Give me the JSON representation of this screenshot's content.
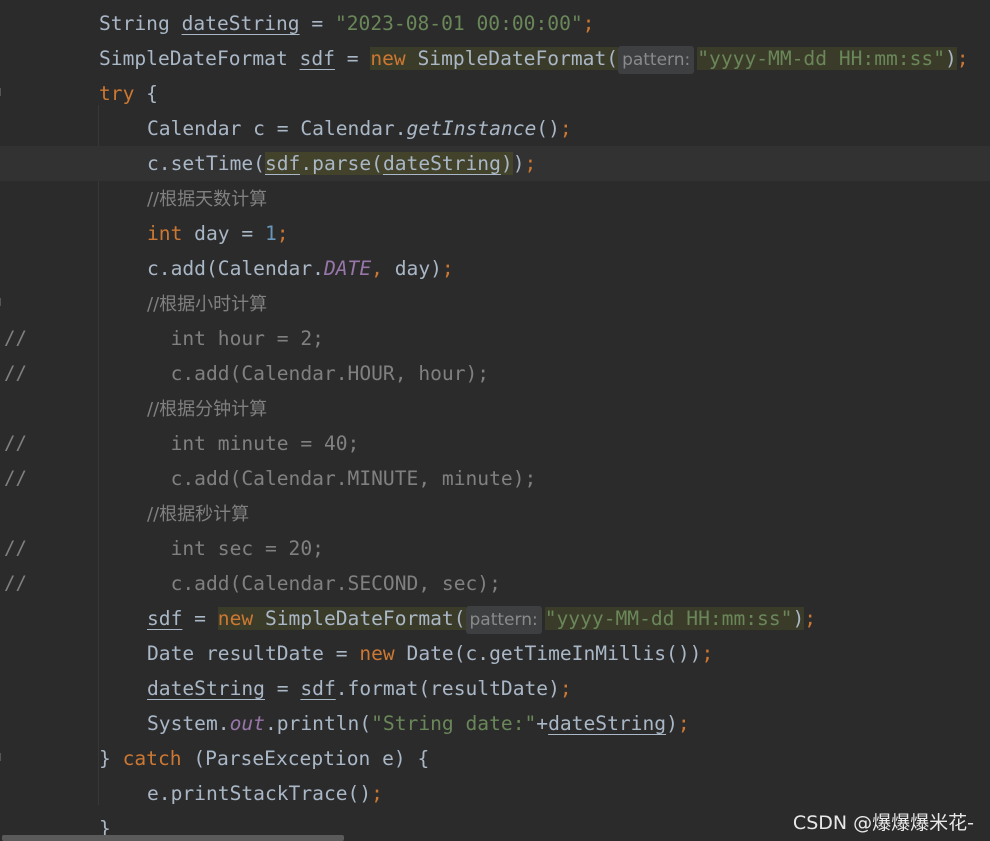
{
  "lines": [
    {
      "gutter": "",
      "segments": [
        {
          "t": "String ",
          "c": "p"
        },
        {
          "t": "dateString",
          "c": "p uline"
        },
        {
          "t": " = ",
          "c": "p"
        },
        {
          "t": "\"2023-08-01 00:00:00\"",
          "c": "str"
        },
        {
          "t": ";",
          "c": "kw"
        }
      ]
    },
    {
      "gutter": "",
      "segments": [
        {
          "t": "SimpleDateFormat ",
          "c": "p"
        },
        {
          "t": "sdf",
          "c": "p uline"
        },
        {
          "t": " = ",
          "c": "p"
        },
        {
          "t": "new",
          "c": "kw hl"
        },
        {
          "t": " SimpleDateFormat(",
          "c": "p hl"
        },
        {
          "t": "pattern:",
          "c": "hint"
        },
        {
          "t": "\"yyyy-MM-dd HH:mm:ss\"",
          "c": "str hl"
        },
        {
          "t": ")",
          "c": "p hl"
        },
        {
          "t": ";",
          "c": "kw"
        }
      ]
    },
    {
      "gutter": "",
      "segments": [
        {
          "t": "try",
          "c": "kw"
        },
        {
          "t": " {",
          "c": "p"
        }
      ]
    },
    {
      "gutter": "",
      "segments": [
        {
          "t": "Calendar c = Calendar.",
          "c": "p"
        },
        {
          "t": "getInstance",
          "c": "p mth"
        },
        {
          "t": "()",
          "c": "p"
        },
        {
          "t": ";",
          "c": "kw"
        }
      ]
    },
    {
      "gutter": "",
      "current": true,
      "segments": [
        {
          "t": "c.setTime(",
          "c": "p"
        },
        {
          "t": "sdf",
          "c": "p uline hlb"
        },
        {
          "t": ".parse(",
          "c": "p hlb"
        },
        {
          "t": "dateString",
          "c": "p uline hlb"
        },
        {
          "t": ")",
          "c": "p hlb"
        },
        {
          "t": ")",
          "c": "p"
        },
        {
          "t": ";",
          "c": "kw"
        }
      ]
    },
    {
      "gutter": "",
      "segments": [
        {
          "t": "//根据天数计算",
          "c": "cm"
        }
      ]
    },
    {
      "gutter": "",
      "segments": [
        {
          "t": "int",
          "c": "kw"
        },
        {
          "t": " day = ",
          "c": "p"
        },
        {
          "t": "1",
          "c": "num"
        },
        {
          "t": ";",
          "c": "kw"
        }
      ]
    },
    {
      "gutter": "",
      "segments": [
        {
          "t": "c.add(Calendar.",
          "c": "p"
        },
        {
          "t": "DATE",
          "c": "field"
        },
        {
          "t": ", ",
          "c": "kw"
        },
        {
          "t": "day)",
          "c": "p"
        },
        {
          "t": ";",
          "c": "kw"
        }
      ]
    },
    {
      "gutter": "",
      "segments": [
        {
          "t": "//根据小时计算",
          "c": "cm"
        }
      ]
    },
    {
      "gutter": "//",
      "segments": [
        {
          "t": "  int hour = 2;",
          "c": "cmm"
        }
      ]
    },
    {
      "gutter": "//",
      "segments": [
        {
          "t": "  c.add(Calendar.HOUR, hour);",
          "c": "cmm"
        }
      ]
    },
    {
      "gutter": "",
      "segments": [
        {
          "t": "//根据分钟计算",
          "c": "cm"
        }
      ]
    },
    {
      "gutter": "//",
      "segments": [
        {
          "t": "  int minute = 40;",
          "c": "cmm"
        }
      ]
    },
    {
      "gutter": "//",
      "segments": [
        {
          "t": "  c.add(Calendar.MINUTE, minute);",
          "c": "cmm"
        }
      ]
    },
    {
      "gutter": "",
      "segments": [
        {
          "t": "//根据秒计算",
          "c": "cm"
        }
      ]
    },
    {
      "gutter": "//",
      "segments": [
        {
          "t": "  int sec = 20;",
          "c": "cmm"
        }
      ]
    },
    {
      "gutter": "//",
      "segments": [
        {
          "t": "  c.add(Calendar.SECOND, sec);",
          "c": "cmm"
        }
      ]
    },
    {
      "gutter": "",
      "segments": [
        {
          "t": "sdf",
          "c": "p uline"
        },
        {
          "t": " = ",
          "c": "p"
        },
        {
          "t": "new",
          "c": "kw hl"
        },
        {
          "t": " SimpleDateFormat(",
          "c": "p hl"
        },
        {
          "t": "pattern:",
          "c": "hint"
        },
        {
          "t": "\"yyyy-MM-dd HH:mm:ss\"",
          "c": "str hl"
        },
        {
          "t": ")",
          "c": "p hl"
        },
        {
          "t": ";",
          "c": "kw"
        }
      ]
    },
    {
      "gutter": "",
      "segments": [
        {
          "t": "Date resultDate = ",
          "c": "p"
        },
        {
          "t": "new",
          "c": "kw"
        },
        {
          "t": " Date(c.getTimeInMillis())",
          "c": "p"
        },
        {
          "t": ";",
          "c": "kw"
        }
      ]
    },
    {
      "gutter": "",
      "segments": [
        {
          "t": "dateString",
          "c": "p uline"
        },
        {
          "t": " = ",
          "c": "p"
        },
        {
          "t": "sdf",
          "c": "p uline"
        },
        {
          "t": ".format(resultDate)",
          "c": "p"
        },
        {
          "t": ";",
          "c": "kw"
        }
      ]
    },
    {
      "gutter": "",
      "segments": [
        {
          "t": "System.",
          "c": "p"
        },
        {
          "t": "out",
          "c": "field"
        },
        {
          "t": ".println(",
          "c": "p"
        },
        {
          "t": "\"String date:\"",
          "c": "str"
        },
        {
          "t": "+",
          "c": "p"
        },
        {
          "t": "dateString",
          "c": "p uline"
        },
        {
          "t": ")",
          "c": "p"
        },
        {
          "t": ";",
          "c": "kw"
        }
      ]
    },
    {
      "gutter": "",
      "segments": [
        {
          "t": "} ",
          "c": "p"
        },
        {
          "t": "catch",
          "c": "kw"
        },
        {
          "t": " (ParseException e) {",
          "c": "p"
        }
      ]
    },
    {
      "gutter": "",
      "segments": [
        {
          "t": "e.printStackTrace()",
          "c": "p"
        },
        {
          "t": ";",
          "c": "kw"
        }
      ]
    },
    {
      "gutter": "",
      "segments": [
        {
          "t": "}",
          "c": "p"
        }
      ]
    }
  ],
  "watermark": "CSDN @爆爆爆米花-",
  "colors": {
    "background": "#2b2b2b",
    "plain": "#a9b7c6",
    "keyword": "#cc7832",
    "string": "#6a8759",
    "number": "#6897bb",
    "comment": "#808080",
    "field": "#9876aa"
  }
}
